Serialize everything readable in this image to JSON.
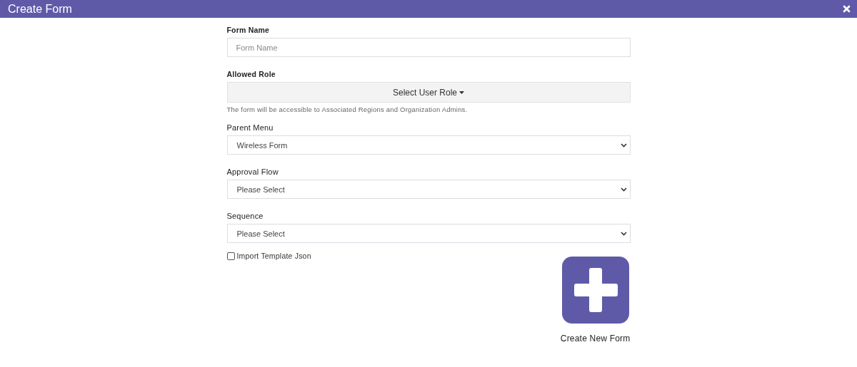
{
  "window": {
    "title": "Create Form"
  },
  "fields": [
    {
      "kind": "text",
      "label": "Form Name",
      "placeholder": "Form Name"
    },
    {
      "kind": "role",
      "label": "Allowed Role",
      "value": "Select User Role",
      "help": "The form will be accessible to Associated Regions and Organization Admins."
    },
    {
      "kind": "select",
      "label": "Parent Menu",
      "value": "Wireless Form"
    },
    {
      "kind": "select",
      "label": "Approval Flow",
      "value": "Please Select"
    },
    {
      "kind": "select",
      "label": "Sequence",
      "value": "Please Select"
    }
  ],
  "import_template": {
    "label": "Import Template Json",
    "checked": false
  },
  "create_button": {
    "label": "Create New Form"
  }
}
